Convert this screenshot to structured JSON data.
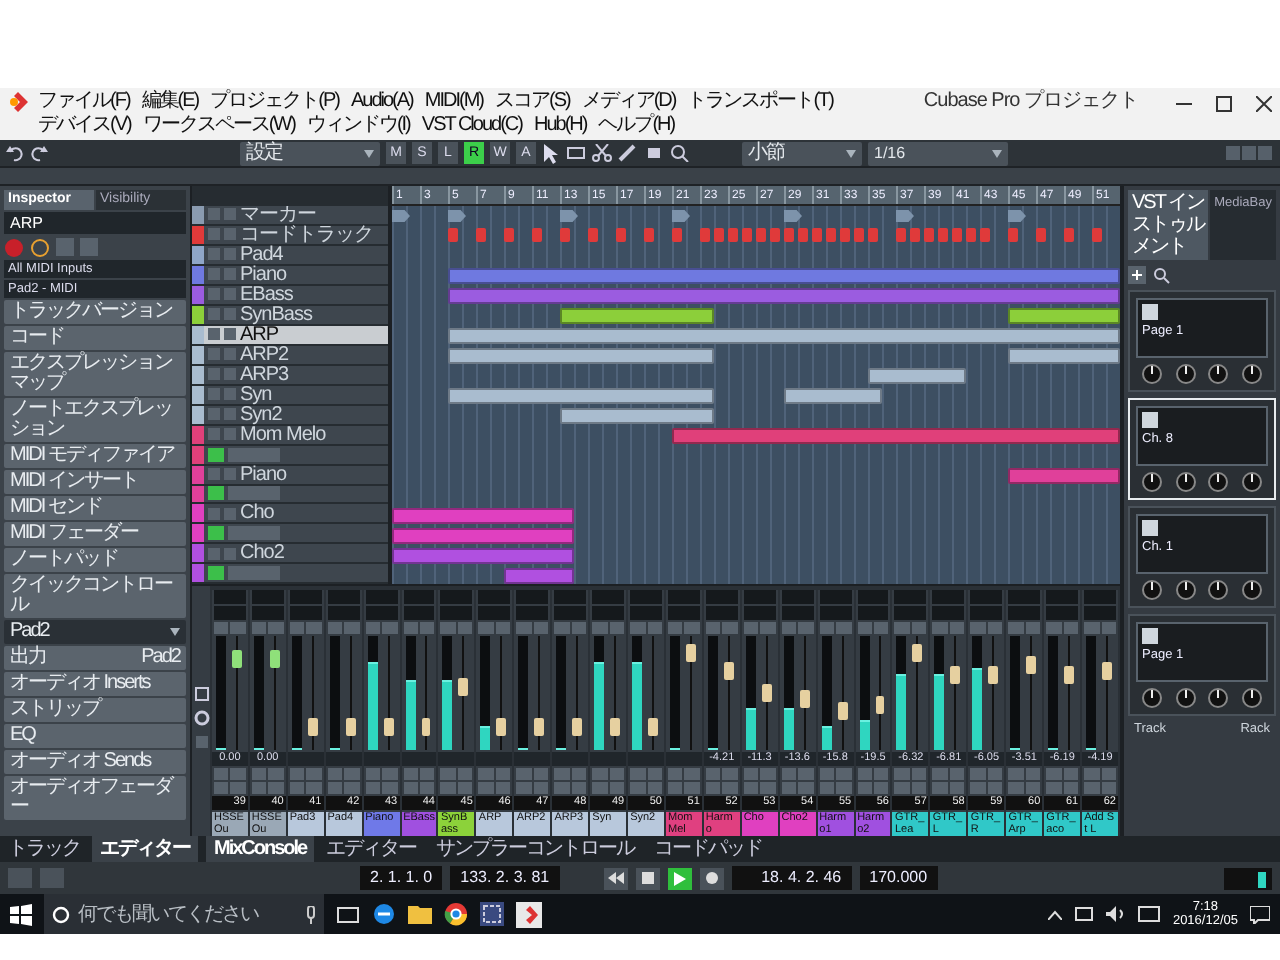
{
  "window": {
    "title": "Cubase Pro プロジェクト",
    "menus": [
      "ファイル(F)",
      "編集(E)",
      "プロジェクト(P)",
      "Audio(A)",
      "MIDI(M)",
      "スコア(S)",
      "メディア(D)",
      "トランスポート(T)",
      "デバイス(V)",
      "ワークスペース(W)",
      "ウィンドウ(I)",
      "VST Cloud(C)",
      "Hub(H)",
      "ヘルプ(H)"
    ]
  },
  "toolbar": {
    "preset": "設定",
    "buttons": [
      {
        "label": "M",
        "on": false
      },
      {
        "label": "S",
        "on": false
      },
      {
        "label": "L",
        "on": false
      },
      {
        "label": "R",
        "on": true
      },
      {
        "label": "W",
        "on": false
      },
      {
        "label": "A",
        "on": false
      }
    ],
    "grid_type": "小節",
    "quantize": "1/16"
  },
  "inspector": {
    "tabs": [
      {
        "label": "Inspector",
        "selected": true
      },
      {
        "label": "Visibility",
        "selected": false
      }
    ],
    "track_name": "ARP",
    "routing": [
      "All MIDI Inputs",
      "Pad2 - MIDI"
    ],
    "sections": [
      {
        "kind": "section",
        "label": "トラックバージョン"
      },
      {
        "kind": "section",
        "label": "コード"
      },
      {
        "kind": "section",
        "label": "エクスプレッションマップ"
      },
      {
        "kind": "section",
        "label": "ノートエクスプレッション"
      },
      {
        "kind": "section",
        "label": "MIDI モディファイア"
      },
      {
        "kind": "section",
        "label": "MIDI インサート"
      },
      {
        "kind": "section",
        "label": "MIDI センド"
      },
      {
        "kind": "section",
        "label": "MIDI フェーダー"
      },
      {
        "kind": "section",
        "label": "ノートパッド"
      },
      {
        "kind": "section",
        "label": "クイックコントロール"
      },
      {
        "kind": "dropdown",
        "label": "Pad2"
      },
      {
        "kind": "pair",
        "label": "出力",
        "value": "Pad2"
      },
      {
        "kind": "section",
        "label": "オーディオ Inserts"
      },
      {
        "kind": "section",
        "label": "ストリップ"
      },
      {
        "kind": "section",
        "label": "EQ"
      },
      {
        "kind": "section",
        "label": "オーディオ Sends"
      },
      {
        "kind": "section",
        "label": "オーディオフェーダー"
      }
    ]
  },
  "tracks": [
    {
      "kind": "marker",
      "name": "マーカー",
      "color": "#8a9bb0",
      "selected": false
    },
    {
      "kind": "chord",
      "name": "コードトラック",
      "color": "#e03a3a",
      "selected": false
    },
    {
      "kind": "instrument",
      "name": "Pad4",
      "color": "#8fa6c8",
      "selected": false
    },
    {
      "kind": "instrument",
      "name": "Piano",
      "color": "#6f79e0",
      "selected": false
    },
    {
      "kind": "instrument",
      "name": "EBass",
      "color": "#9b5ce0",
      "selected": false
    },
    {
      "kind": "instrument",
      "name": "SynBass",
      "color": "#8ccf3a",
      "selected": false
    },
    {
      "kind": "instrument",
      "name": "ARP",
      "color": "#a9bccf",
      "selected": true
    },
    {
      "kind": "instrument",
      "name": "ARP2",
      "color": "#a9bccf",
      "selected": false
    },
    {
      "kind": "instrument",
      "name": "ARP3",
      "color": "#a9bccf",
      "selected": false
    },
    {
      "kind": "instrument",
      "name": "Syn",
      "color": "#a9bccf",
      "selected": false
    },
    {
      "kind": "instrument",
      "name": "Syn2",
      "color": "#a9bccf",
      "selected": false
    },
    {
      "kind": "folder",
      "name": "Mom Melo",
      "color": "#e0407a",
      "selected": false
    },
    {
      "kind": "lane",
      "color": "#e0407a",
      "selected": false
    },
    {
      "kind": "instrument",
      "name": "Piano",
      "color": "#e0409a",
      "selected": false
    },
    {
      "kind": "lane",
      "color": "#e0409a",
      "selected": false
    },
    {
      "kind": "instrument",
      "name": "Cho",
      "color": "#e040c0",
      "selected": false
    },
    {
      "kind": "lane",
      "color": "#e040c0",
      "selected": false
    },
    {
      "kind": "instrument",
      "name": "Cho2",
      "color": "#b050e0",
      "selected": false
    },
    {
      "kind": "lane",
      "color": "#b050e0",
      "selected": false
    }
  ],
  "arrange": {
    "ruler": [
      "1",
      "3",
      "5",
      "7",
      "9",
      "11",
      "13",
      "15",
      "17",
      "19",
      "21",
      "23",
      "25",
      "27",
      "29",
      "31",
      "33",
      "35",
      "37",
      "39",
      "41",
      "43",
      "45",
      "47",
      "49",
      "51"
    ]
  },
  "mixer": {
    "channels": [
      {
        "kind": "output",
        "number": "39",
        "name": "HSSE Ou",
        "color": "#9aa8b6",
        "fader": {
          "level": 0.8
        },
        "meter": {
          "level": 0
        },
        "reading": "0.00"
      },
      {
        "kind": "output",
        "number": "40",
        "name": "HSSE Ou",
        "color": "#9aa8b6",
        "fader": {
          "level": 0.8
        },
        "meter": {
          "level": 0
        },
        "reading": "0.00"
      },
      {
        "kind": "instrument",
        "number": "41",
        "name": "Pad3",
        "color": "#b8c8dc",
        "fader": {
          "level": 0.2
        },
        "meter": {
          "level": 0
        }
      },
      {
        "kind": "instrument",
        "number": "42",
        "name": "Pad4",
        "color": "#b8c8dc",
        "fader": {
          "level": 0.2
        },
        "meter": {
          "level": 0
        }
      },
      {
        "kind": "instrument",
        "number": "43",
        "name": "Piano",
        "color": "#6f79e8",
        "fader": {
          "level": 0.2
        },
        "meter": {
          "level": 0.75
        }
      },
      {
        "kind": "instrument",
        "number": "44",
        "name": "EBass",
        "color": "#a050e0",
        "fader": {
          "level": 0.2
        },
        "meter": {
          "level": 0.6
        }
      },
      {
        "kind": "instrument",
        "number": "45",
        "name": "SynBass",
        "color": "#8cd23a",
        "fader": {
          "level": 0.55
        },
        "meter": {
          "level": 0.6
        }
      },
      {
        "kind": "instrument",
        "number": "46",
        "name": "ARP",
        "color": "#b8c8dc",
        "fader": {
          "level": 0.2
        },
        "meter": {
          "level": 0.2
        }
      },
      {
        "kind": "instrument",
        "number": "47",
        "name": "ARP2",
        "color": "#b8c8dc",
        "fader": {
          "level": 0.2
        },
        "meter": {
          "level": 0
        }
      },
      {
        "kind": "instrument",
        "number": "48",
        "name": "ARP3",
        "color": "#b8c8dc",
        "fader": {
          "level": 0.2
        },
        "meter": {
          "level": 0
        }
      },
      {
        "kind": "instrument",
        "number": "49",
        "name": "Syn",
        "color": "#b8c8dc",
        "fader": {
          "level": 0.2
        },
        "meter": {
          "level": 0.75
        }
      },
      {
        "kind": "instrument",
        "number": "50",
        "name": "Syn2",
        "color": "#b8c8dc",
        "fader": {
          "level": 0.2
        },
        "meter": {
          "level": 0.75
        }
      },
      {
        "kind": "instrument",
        "number": "51",
        "name": "Mom Mel",
        "color": "#e04080",
        "fader": {
          "level": 0.85
        },
        "meter": {
          "level": 0
        }
      },
      {
        "kind": "instrument",
        "number": "52",
        "name": "Harmo",
        "color": "#e04080",
        "fader": {
          "level": 0.7
        },
        "meter": {
          "level": 0
        },
        "reading": "-4.21"
      },
      {
        "kind": "instrument",
        "number": "53",
        "name": "Cho",
        "color": "#e040c0",
        "fader": {
          "level": 0.5
        },
        "meter": {
          "level": 0.35
        },
        "reading": "-11.3"
      },
      {
        "kind": "instrument",
        "number": "54",
        "name": "Cho2",
        "color": "#e040c0",
        "fader": {
          "level": 0.45
        },
        "meter": {
          "level": 0.35
        },
        "reading": "-13.6"
      },
      {
        "kind": "instrument",
        "number": "55",
        "name": "Harmo1",
        "color": "#a050e0",
        "fader": {
          "level": 0.35
        },
        "meter": {
          "level": 0.2
        },
        "reading": "-15.8"
      },
      {
        "kind": "instrument",
        "number": "56",
        "name": "Harmo2",
        "color": "#a050e0",
        "fader": {
          "level": 0.4
        },
        "meter": {
          "level": 0.25
        },
        "reading": "-19.5"
      },
      {
        "kind": "instrument",
        "number": "57",
        "name": "GTR_Lea",
        "color": "#30c8c8",
        "fader": {
          "level": 0.85
        },
        "meter": {
          "level": 0.65
        },
        "reading": "-6.32"
      },
      {
        "kind": "instrument",
        "number": "58",
        "name": "GTR_L",
        "color": "#30c8c8",
        "fader": {
          "level": 0.65
        },
        "meter": {
          "level": 0.65
        },
        "reading": "-6.81"
      },
      {
        "kind": "instrument",
        "number": "59",
        "name": "GTR_R",
        "color": "#30c8c8",
        "fader": {
          "level": 0.65
        },
        "meter": {
          "level": 0.7
        },
        "reading": "-6.05"
      },
      {
        "kind": "instrument",
        "number": "60",
        "name": "GTR_Arp",
        "color": "#30c8c8",
        "fader": {
          "level": 0.75
        },
        "meter": {
          "level": 0
        },
        "reading": "-3.51"
      },
      {
        "kind": "instrument",
        "number": "61",
        "name": "GTR_aco",
        "color": "#30c8c8",
        "fader": {
          "level": 0.65
        },
        "meter": {
          "level": 0
        },
        "reading": "-6.19"
      },
      {
        "kind": "instrument",
        "number": "62",
        "name": "Add St L",
        "color": "#30c8c8",
        "fader": {
          "level": 0.7
        },
        "meter": {
          "level": 0
        },
        "reading": "-4.19"
      }
    ]
  },
  "rack": {
    "tabs": [
      {
        "label": "VST インストゥルメント",
        "selected": true
      },
      {
        "label": "MediaBay",
        "selected": false
      }
    ],
    "slots": [
      {
        "info": "Page 1",
        "selected": false
      },
      {
        "info": "Ch. 8",
        "selected": true
      },
      {
        "info": "Ch. 1",
        "selected": false
      },
      {
        "info": "Page 1",
        "selected": false
      }
    ],
    "footer": [
      "Track",
      "Rack"
    ]
  },
  "bottom_tabs": {
    "left": [
      {
        "label": "トラック",
        "selected": false
      },
      {
        "label": "エディター",
        "selected": true
      }
    ],
    "center": [
      {
        "label": "MixConsole",
        "selected": true
      },
      {
        "label": "エディター",
        "selected": false
      },
      {
        "label": "サンプラーコントロール",
        "selected": false
      },
      {
        "label": "コードパッド",
        "selected": false
      }
    ]
  },
  "transport": {
    "left_locator": "2. 1. 1. 0",
    "right_locator": "133. 2. 3. 81",
    "playing": true,
    "position": "18. 4. 2. 46",
    "tempo": "170.000"
  },
  "taskbar": {
    "search_placeholder": "何でも聞いてください",
    "time": "7:18",
    "date": "2016/12/05"
  }
}
